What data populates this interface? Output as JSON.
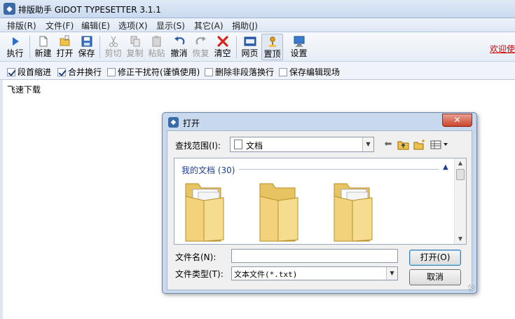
{
  "window": {
    "title": "排版助手 GIDOT TYPESETTER 3.1.1"
  },
  "menu": [
    "排版(R)",
    "文件(F)",
    "编辑(E)",
    "选项(X)",
    "显示(S)",
    "其它(A)",
    "捐助(J)"
  ],
  "toolbar": {
    "run": "执行",
    "new": "新建",
    "open": "打开",
    "save": "保存",
    "cut": "剪切",
    "copy": "复制",
    "paste": "粘贴",
    "undo": "撤消",
    "redo": "恢复",
    "clear": "清空",
    "web": "网页",
    "top": "置顶",
    "settings": "设置",
    "welcome": "欢迎使"
  },
  "options": {
    "indent": {
      "label": "段首缩进",
      "checked": true
    },
    "merge": {
      "label": "合并换行",
      "checked": true
    },
    "fix": {
      "label": "修正干扰符(谨慎使用)",
      "checked": false
    },
    "delete_breaks": {
      "label": "删除非段落换行",
      "checked": false
    },
    "save_scene": {
      "label": "保存编辑现场",
      "checked": false
    }
  },
  "editor": {
    "text": "飞速下载"
  },
  "colors": {
    "accent": "#1e3f8f",
    "welcome": "#d60000",
    "close_button": "#c9442b"
  },
  "dialog": {
    "title": "打开",
    "close_glyph": "✕",
    "look_in_label": "查找范围(I):",
    "look_in_value": "文档",
    "group_header": "我的文档 (30)",
    "file_name_label": "文件名(N):",
    "file_name_value": "",
    "file_type_label": "文件类型(T):",
    "file_type_value": "文本文件(*.txt)",
    "open_button": "打开(O)",
    "cancel_button": "取消"
  }
}
